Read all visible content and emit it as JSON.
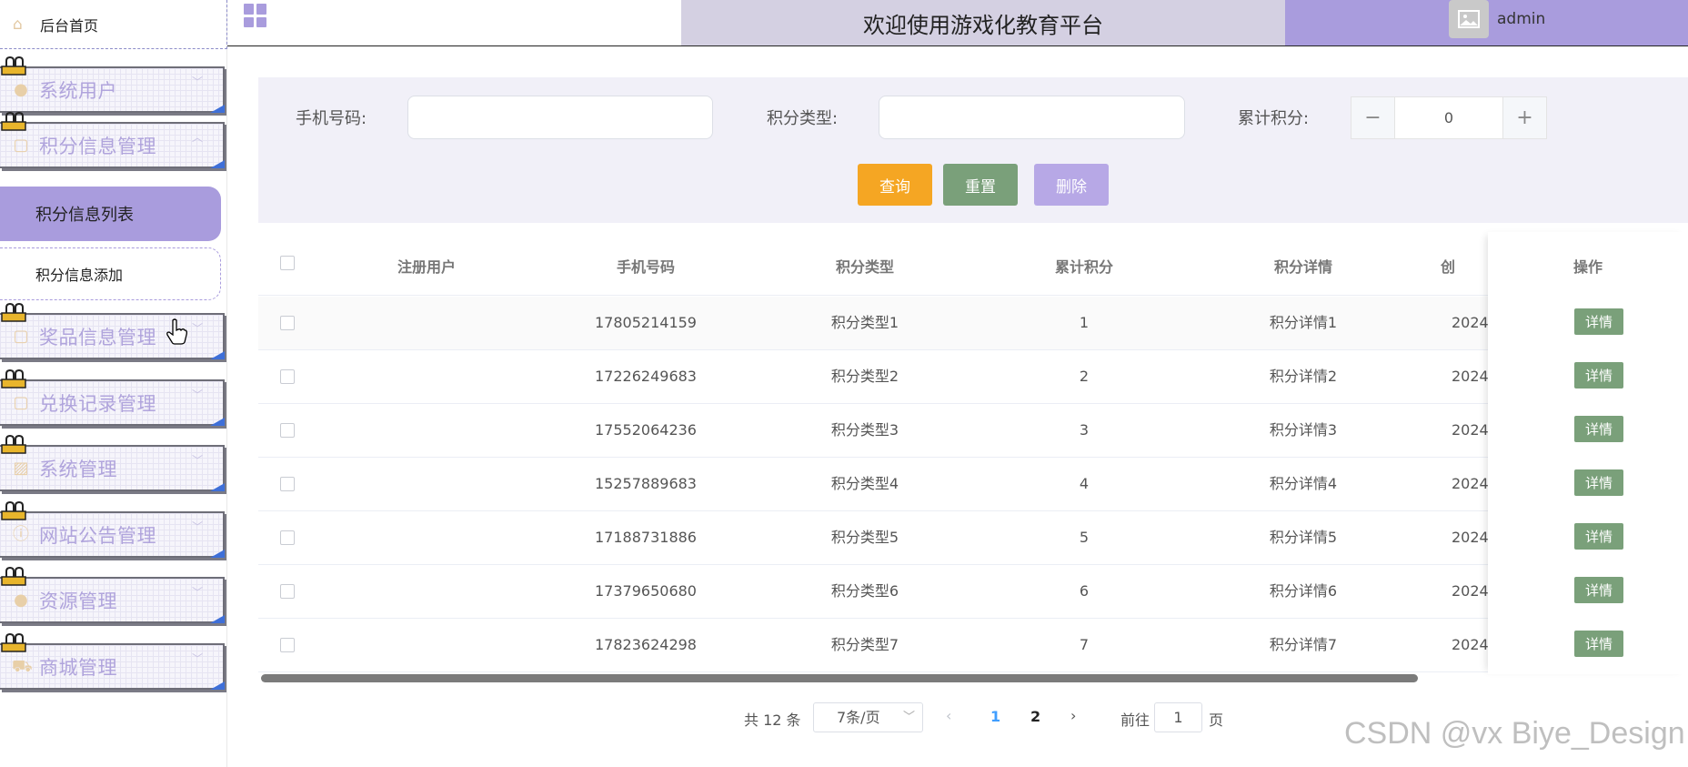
{
  "sidebar": {
    "home": "后台首页",
    "groups": [
      {
        "label": "系统用户",
        "icon": "user-icon"
      },
      {
        "label": "积分信息管理",
        "icon": "document-icon"
      },
      {
        "label": "奖品信息管理",
        "icon": "document-icon"
      },
      {
        "label": "兑换记录管理",
        "icon": "document-icon"
      },
      {
        "label": "系统管理",
        "icon": "image-icon"
      },
      {
        "label": "网站公告管理",
        "icon": "info-icon"
      },
      {
        "label": "资源管理",
        "icon": "bulb-icon"
      },
      {
        "label": "商城管理",
        "icon": "cart-icon"
      }
    ],
    "sub_items": [
      "积分信息列表",
      "积分信息添加"
    ]
  },
  "header": {
    "title": "欢迎使用游戏化教育平台",
    "username": "admin"
  },
  "search": {
    "phone_label": "手机号码:",
    "type_label": "积分类型:",
    "total_label": "累计积分:",
    "total_value": "0",
    "query_btn": "查询",
    "reset_btn": "重置",
    "delete_btn": "删除"
  },
  "table": {
    "columns": [
      "注册用户",
      "手机号码",
      "积分类型",
      "累计积分",
      "积分详情",
      "创",
      "操作"
    ],
    "rows": [
      {
        "user": "",
        "phone": "17805214159",
        "type": "积分类型1",
        "total": "1",
        "detail": "积分详情1",
        "created": "2024-"
      },
      {
        "user": "",
        "phone": "17226249683",
        "type": "积分类型2",
        "total": "2",
        "detail": "积分详情2",
        "created": "2024-"
      },
      {
        "user": "",
        "phone": "17552064236",
        "type": "积分类型3",
        "total": "3",
        "detail": "积分详情3",
        "created": "2024-"
      },
      {
        "user": "",
        "phone": "15257889683",
        "type": "积分类型4",
        "total": "4",
        "detail": "积分详情4",
        "created": "2024-"
      },
      {
        "user": "",
        "phone": "17188731886",
        "type": "积分类型5",
        "total": "5",
        "detail": "积分详情5",
        "created": "2024-"
      },
      {
        "user": "",
        "phone": "17379650680",
        "type": "积分类型6",
        "total": "6",
        "detail": "积分详情6",
        "created": "2024-"
      },
      {
        "user": "",
        "phone": "17823624298",
        "type": "积分类型7",
        "total": "7",
        "detail": "积分详情7",
        "created": "2024-"
      }
    ],
    "detail_btn": "详情"
  },
  "pagination": {
    "total": "共 12 条",
    "page_size": "7条/页",
    "pages": [
      "1",
      "2"
    ],
    "current": "1",
    "goto_label": "前往",
    "goto_value": "1",
    "page_unit": "页"
  },
  "watermark": "CSDN @vx Biye_Design",
  "colors": {
    "accent": "#a99cdd",
    "title_bg": "#d4d0e2",
    "query": "#f5a623",
    "reset": "#7aa07a",
    "delete": "#b7a8e6"
  }
}
